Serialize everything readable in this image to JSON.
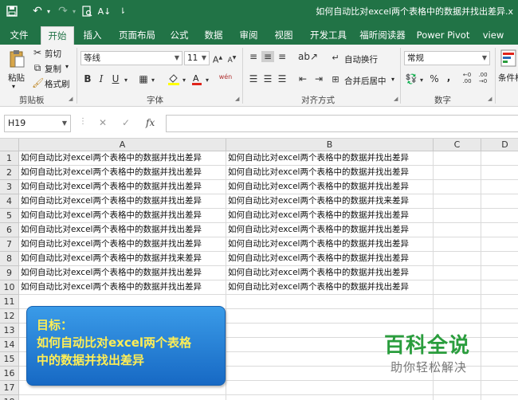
{
  "titlebar": {
    "save_icon": "save-icon",
    "undo_icon": "undo-icon",
    "redo_icon": "redo-icon",
    "print_preview_icon": "print-preview-icon",
    "sort_icon": "sort-ascending-icon",
    "doc_title": "如何自动比对excel两个表格中的数据并找出差异.x"
  },
  "tabs": [
    "文件",
    "开始",
    "插入",
    "页面布局",
    "公式",
    "数据",
    "审阅",
    "视图",
    "开发工具",
    "福昕阅读器",
    "Power Pivot",
    "view"
  ],
  "active_tab": "开始",
  "ribbon": {
    "clipboard": {
      "paste": "粘贴",
      "cut": "剪切",
      "copy": "复制",
      "format_painter": "格式刷",
      "group": "剪贴板"
    },
    "font": {
      "font_name": "等线",
      "font_size": "11",
      "bold": "B",
      "italic": "I",
      "underline": "U",
      "wen": "wén",
      "group": "字体"
    },
    "alignment": {
      "wrap_text": "自动换行",
      "merge_center": "合并后居中",
      "group": "对齐方式"
    },
    "number": {
      "format": "常规",
      "percent": "%",
      "comma": ",",
      "group": "数字"
    },
    "styles": {
      "conditional_format": "条件格"
    }
  },
  "formula_bar": {
    "name_box": "H19",
    "cancel": "✕",
    "enter": "✓",
    "fx": "fx",
    "value": ""
  },
  "sheet": {
    "columns": [
      "A",
      "B",
      "C",
      "D"
    ],
    "rows": [
      "1",
      "2",
      "3",
      "4",
      "5",
      "6",
      "7",
      "8",
      "9",
      "10",
      "11",
      "12",
      "13",
      "14",
      "15",
      "16",
      "17",
      "18"
    ],
    "col_a": [
      "如何自动比对excel两个表格中的数据并找出差异",
      "如何自动比对excel两个表格中的数据并找出差异",
      "如何自动比对excel两个表格中的数据并找出差异",
      "如何自动比对excel两个表格中的数据并找出差异",
      "如何自动比对excel两个表格中的数据并找出差异",
      "如何自动比对excel两个表格中的数据并找出差异",
      "如何自动比对excel两个表格中的数据并找出差异",
      "如何自动比对excel两个表格中的数据并找来差异",
      "如何自动比对excel两个表格中的数据并找出差异",
      "如何自动比对excel两个表格中的数据并找出差异"
    ],
    "col_b": [
      "如何自动比对excel两个表格中的数据并找出差异",
      "如何自动比对excel两个表格中的数据并找出差异",
      "如何自动比对excel两个表格中的数据并找出差异",
      "如何自动比对excel两个表格中的数据并找来差异",
      "如何自动比对excel两个表格中的数据并找出差异",
      "如何自动比对excel两个表格中的数据并找出差异",
      "如何自动比对excel两个表格中的数据并找出差异",
      "如何自动比对excel两个表格中的数据并找出差异",
      "如何自动比对excel两个表格中的数据并找出差异",
      "如何自动比对excel两个表格中的数据并找出差异"
    ]
  },
  "goal_box": {
    "line1": "目标：",
    "line2": "如何自动比对excel两个表格",
    "line3": "中的数据并找出差异"
  },
  "watermark": {
    "logo": "百科全说",
    "sub": "助你轻松解决"
  },
  "colors": {
    "excel_green": "#217346",
    "goal_blue": "#2a82d8",
    "goal_text": "#ffee55",
    "watermark_green": "#2a9d3d"
  }
}
